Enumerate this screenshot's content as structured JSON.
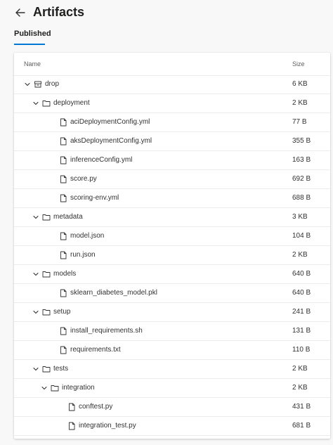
{
  "header": {
    "title": "Artifacts",
    "back_icon": "back-arrow-icon"
  },
  "tabs": [
    {
      "label": "Published",
      "active": true
    }
  ],
  "accent_color": "#0078d4",
  "table": {
    "columns": {
      "name": "Name",
      "size": "Size"
    },
    "rows": [
      {
        "name": "drop",
        "size": "6 KB",
        "kind": "artifact",
        "depth": 0,
        "expanded": true
      },
      {
        "name": "deployment",
        "size": "2 KB",
        "kind": "folder",
        "depth": 1,
        "expanded": true
      },
      {
        "name": "aciDeploymentConfig.yml",
        "size": "77 B",
        "kind": "file",
        "depth": 2
      },
      {
        "name": "aksDeploymentConfig.yml",
        "size": "355 B",
        "kind": "file",
        "depth": 2
      },
      {
        "name": "inferenceConfig.yml",
        "size": "163 B",
        "kind": "file",
        "depth": 2
      },
      {
        "name": "score.py",
        "size": "692 B",
        "kind": "file",
        "depth": 2
      },
      {
        "name": "scoring-env.yml",
        "size": "688 B",
        "kind": "file",
        "depth": 2
      },
      {
        "name": "metadata",
        "size": "3 KB",
        "kind": "folder",
        "depth": 1,
        "expanded": true
      },
      {
        "name": "model.json",
        "size": "104 B",
        "kind": "file",
        "depth": 2
      },
      {
        "name": "run.json",
        "size": "2 KB",
        "kind": "file",
        "depth": 2
      },
      {
        "name": "models",
        "size": "640 B",
        "kind": "folder",
        "depth": 1,
        "expanded": true
      },
      {
        "name": "sklearn_diabetes_model.pkl",
        "size": "640 B",
        "kind": "file",
        "depth": 2
      },
      {
        "name": "setup",
        "size": "241 B",
        "kind": "folder",
        "depth": 1,
        "expanded": true
      },
      {
        "name": "install_requirements.sh",
        "size": "131 B",
        "kind": "file",
        "depth": 2
      },
      {
        "name": "requirements.txt",
        "size": "110 B",
        "kind": "file",
        "depth": 2
      },
      {
        "name": "tests",
        "size": "2 KB",
        "kind": "folder",
        "depth": 1,
        "expanded": true
      },
      {
        "name": "integration",
        "size": "2 KB",
        "kind": "folder",
        "depth": 2,
        "expanded": true
      },
      {
        "name": "conftest.py",
        "size": "431 B",
        "kind": "file",
        "depth": 3
      },
      {
        "name": "integration_test.py",
        "size": "681 B",
        "kind": "file",
        "depth": 3
      }
    ]
  }
}
